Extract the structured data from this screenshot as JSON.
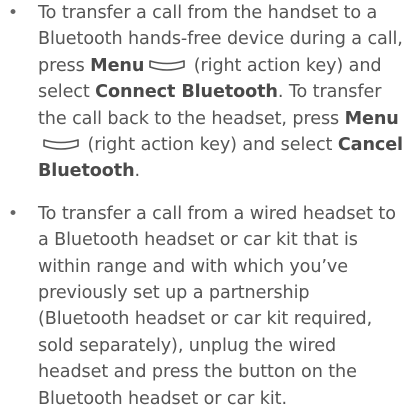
{
  "items": [
    {
      "bullet": "•",
      "t1": "To transfer a call from the handset to a Bluetooth hands-free device during a call, press ",
      "b1": "Menu",
      "icon1": "right-action-key-icon",
      "t2": " (right action key) and select ",
      "b2": "Connect Bluetooth",
      "t3": ". To transfer the call back to the headset, press ",
      "b3": "Menu",
      "icon2": "right-action-key-icon",
      "t4": " (right action key) and select ",
      "b4": "Cancel Bluetooth",
      "t5": "."
    },
    {
      "bullet": "•",
      "text": "To transfer a call from a wired headset to a Bluetooth headset or car kit that is within range and with which you’ve previously set up a partnership (Bluetooth headset or car kit required, sold separately), unplug the wired headset and press the button on the Bluetooth headset or car kit."
    }
  ]
}
